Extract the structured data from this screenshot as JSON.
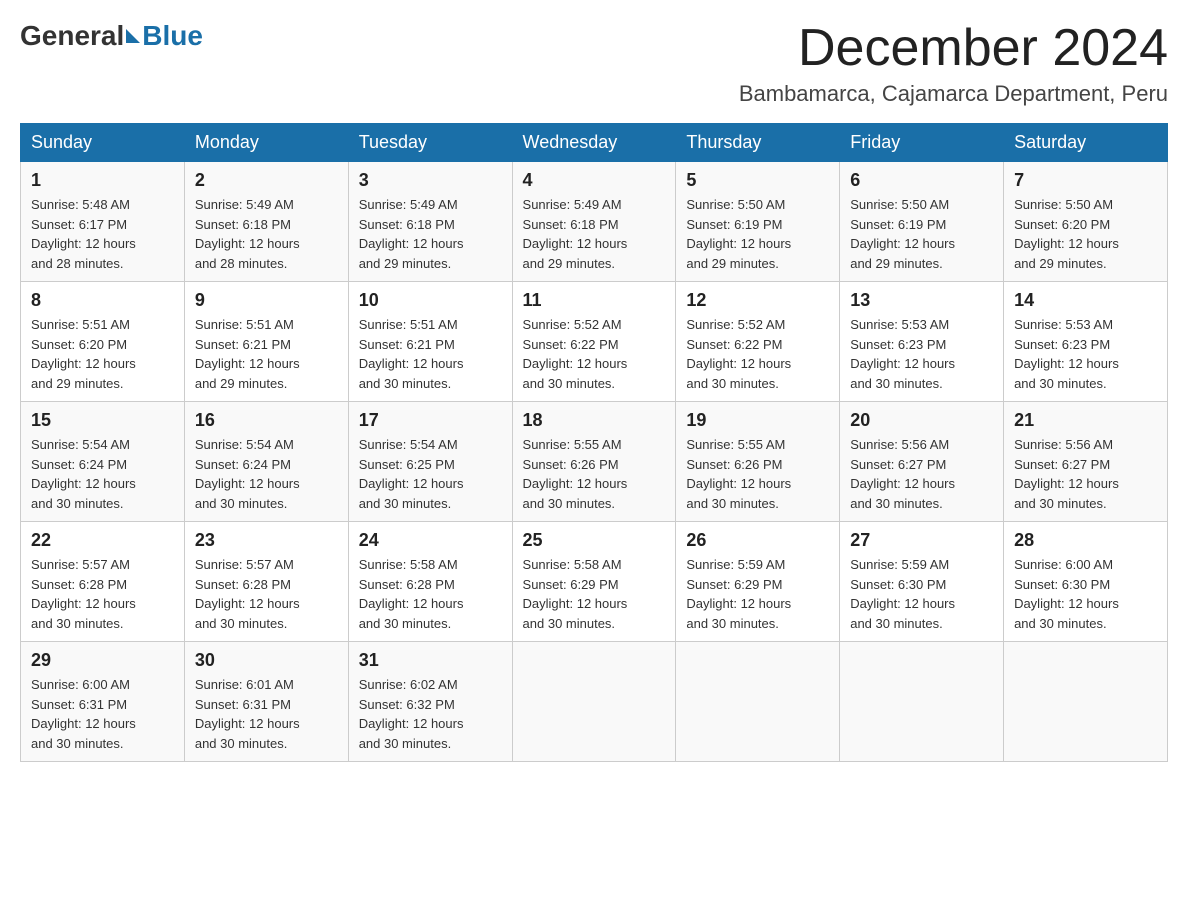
{
  "header": {
    "logo_general": "General",
    "logo_blue": "Blue",
    "month_title": "December 2024",
    "location": "Bambamarca, Cajamarca Department, Peru"
  },
  "days_of_week": [
    "Sunday",
    "Monday",
    "Tuesday",
    "Wednesday",
    "Thursday",
    "Friday",
    "Saturday"
  ],
  "weeks": [
    [
      {
        "day": "1",
        "sunrise": "5:48 AM",
        "sunset": "6:17 PM",
        "daylight": "12 hours and 28 minutes."
      },
      {
        "day": "2",
        "sunrise": "5:49 AM",
        "sunset": "6:18 PM",
        "daylight": "12 hours and 28 minutes."
      },
      {
        "day": "3",
        "sunrise": "5:49 AM",
        "sunset": "6:18 PM",
        "daylight": "12 hours and 29 minutes."
      },
      {
        "day": "4",
        "sunrise": "5:49 AM",
        "sunset": "6:18 PM",
        "daylight": "12 hours and 29 minutes."
      },
      {
        "day": "5",
        "sunrise": "5:50 AM",
        "sunset": "6:19 PM",
        "daylight": "12 hours and 29 minutes."
      },
      {
        "day": "6",
        "sunrise": "5:50 AM",
        "sunset": "6:19 PM",
        "daylight": "12 hours and 29 minutes."
      },
      {
        "day": "7",
        "sunrise": "5:50 AM",
        "sunset": "6:20 PM",
        "daylight": "12 hours and 29 minutes."
      }
    ],
    [
      {
        "day": "8",
        "sunrise": "5:51 AM",
        "sunset": "6:20 PM",
        "daylight": "12 hours and 29 minutes."
      },
      {
        "day": "9",
        "sunrise": "5:51 AM",
        "sunset": "6:21 PM",
        "daylight": "12 hours and 29 minutes."
      },
      {
        "day": "10",
        "sunrise": "5:51 AM",
        "sunset": "6:21 PM",
        "daylight": "12 hours and 30 minutes."
      },
      {
        "day": "11",
        "sunrise": "5:52 AM",
        "sunset": "6:22 PM",
        "daylight": "12 hours and 30 minutes."
      },
      {
        "day": "12",
        "sunrise": "5:52 AM",
        "sunset": "6:22 PM",
        "daylight": "12 hours and 30 minutes."
      },
      {
        "day": "13",
        "sunrise": "5:53 AM",
        "sunset": "6:23 PM",
        "daylight": "12 hours and 30 minutes."
      },
      {
        "day": "14",
        "sunrise": "5:53 AM",
        "sunset": "6:23 PM",
        "daylight": "12 hours and 30 minutes."
      }
    ],
    [
      {
        "day": "15",
        "sunrise": "5:54 AM",
        "sunset": "6:24 PM",
        "daylight": "12 hours and 30 minutes."
      },
      {
        "day": "16",
        "sunrise": "5:54 AM",
        "sunset": "6:24 PM",
        "daylight": "12 hours and 30 minutes."
      },
      {
        "day": "17",
        "sunrise": "5:54 AM",
        "sunset": "6:25 PM",
        "daylight": "12 hours and 30 minutes."
      },
      {
        "day": "18",
        "sunrise": "5:55 AM",
        "sunset": "6:26 PM",
        "daylight": "12 hours and 30 minutes."
      },
      {
        "day": "19",
        "sunrise": "5:55 AM",
        "sunset": "6:26 PM",
        "daylight": "12 hours and 30 minutes."
      },
      {
        "day": "20",
        "sunrise": "5:56 AM",
        "sunset": "6:27 PM",
        "daylight": "12 hours and 30 minutes."
      },
      {
        "day": "21",
        "sunrise": "5:56 AM",
        "sunset": "6:27 PM",
        "daylight": "12 hours and 30 minutes."
      }
    ],
    [
      {
        "day": "22",
        "sunrise": "5:57 AM",
        "sunset": "6:28 PM",
        "daylight": "12 hours and 30 minutes."
      },
      {
        "day": "23",
        "sunrise": "5:57 AM",
        "sunset": "6:28 PM",
        "daylight": "12 hours and 30 minutes."
      },
      {
        "day": "24",
        "sunrise": "5:58 AM",
        "sunset": "6:28 PM",
        "daylight": "12 hours and 30 minutes."
      },
      {
        "day": "25",
        "sunrise": "5:58 AM",
        "sunset": "6:29 PM",
        "daylight": "12 hours and 30 minutes."
      },
      {
        "day": "26",
        "sunrise": "5:59 AM",
        "sunset": "6:29 PM",
        "daylight": "12 hours and 30 minutes."
      },
      {
        "day": "27",
        "sunrise": "5:59 AM",
        "sunset": "6:30 PM",
        "daylight": "12 hours and 30 minutes."
      },
      {
        "day": "28",
        "sunrise": "6:00 AM",
        "sunset": "6:30 PM",
        "daylight": "12 hours and 30 minutes."
      }
    ],
    [
      {
        "day": "29",
        "sunrise": "6:00 AM",
        "sunset": "6:31 PM",
        "daylight": "12 hours and 30 minutes."
      },
      {
        "day": "30",
        "sunrise": "6:01 AM",
        "sunset": "6:31 PM",
        "daylight": "12 hours and 30 minutes."
      },
      {
        "day": "31",
        "sunrise": "6:02 AM",
        "sunset": "6:32 PM",
        "daylight": "12 hours and 30 minutes."
      },
      null,
      null,
      null,
      null
    ]
  ],
  "cell_labels": {
    "sunrise": "Sunrise:",
    "sunset": "Sunset:",
    "daylight": "Daylight:"
  }
}
